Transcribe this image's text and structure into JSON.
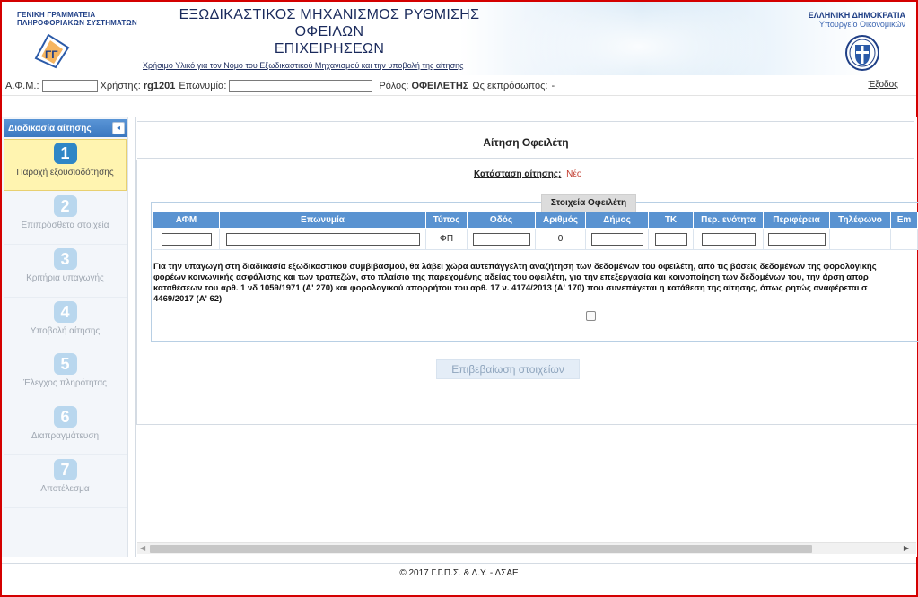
{
  "header": {
    "org_line1": "ΓΕΝΙΚΗ ΓΡΑΜΜΑΤΕΙΑ",
    "org_line2": "ΠΛΗΡΟΦΟΡΙΑΚΩΝ ΣΥΣΤΗΜΑΤΩΝ",
    "title_line1": "ΕΞΩΔΙΚΑΣΤΙΚΟΣ ΜΗΧΑΝΙΣΜΟΣ ΡΥΘΜΙΣΗΣ ΟΦΕΙΛΩΝ",
    "title_line2": "ΕΠΙΧΕΙΡΗΣΕΩΝ",
    "material_link": "Χρήσιμο Υλικό για τον Νόμο του Εξωδικαστικού Μηχανισμού και την υποβολή της αίτησης",
    "republic": "ΕΛΛΗΝΙΚΗ ΔΗΜΟΚΡΑΤΙΑ",
    "ministry": "Υπουργείο Οικονομικών",
    "logo_icon": "ggps-logo-icon",
    "emblem_icon": "greek-emblem-icon"
  },
  "userbar": {
    "afm_label": "Α.Φ.Μ.:",
    "user_label": "Χρήστης:",
    "user_value": "rg1201",
    "name_label": "Επωνυμία:",
    "role_label": "Ρόλος:",
    "role_value": "ΟΦΕΙΛΕΤΗΣ",
    "rep_label": "Ως εκπρόσωπος:",
    "rep_value": "-",
    "logout": "Έξοδος"
  },
  "sidebar": {
    "header": "Διαδικασία αίτησης",
    "collapse_icon": "◂",
    "steps": [
      {
        "num": "1",
        "label": "Παροχή εξουσιοδότησης"
      },
      {
        "num": "2",
        "label": "Επιπρόσθετα στοιχεία"
      },
      {
        "num": "3",
        "label": "Κριτήρια υπαγωγής"
      },
      {
        "num": "4",
        "label": "Υποβολή αίτησης"
      },
      {
        "num": "5",
        "label": "Έλεγχος πληρότητας"
      },
      {
        "num": "6",
        "label": "Διαπραγμάτευση"
      },
      {
        "num": "7",
        "label": "Αποτέλεσμα"
      }
    ]
  },
  "main": {
    "page_title": "Αίτηση Οφειλέτη",
    "status_label": "Κατάσταση αίτησης:",
    "status_value": "Νέο",
    "debtor_tab": "Στοιχεία Οφειλέτη",
    "columns": [
      "ΑΦΜ",
      "Επωνυμία",
      "Τύπος",
      "Οδός",
      "Αριθμός",
      "Δήμος",
      "ΤΚ",
      "Περ. ενότητα",
      "Περιφέρεια",
      "Τηλέφωνο",
      "Em"
    ],
    "row": {
      "type": "ΦΠ",
      "number": "0"
    },
    "legal_line1": "Για την υπαγωγή στη διαδικασία εξωδικαστικού συμβιβασμού, θα λάβει χώρα αυτεπάγγελτη αναζήτηση των δεδομένων του οφειλέτη, από τις βάσεις δεδομένων της φορολογικής",
    "legal_line2": "φορέων κοινωνικής ασφάλισης και των τραπεζών, στο πλαίσιο της παρεχομένης αδείας του οφειλέτη, για την επεξεργασία και κοινοποίηση των δεδομένων του, την άρση απορ",
    "legal_line3": "καταθέσεων του αρθ. 1 νδ 1059/1971 (Α' 270) και φορολογικού απορρήτου του αρθ. 17 ν. 4174/2013 (Α' 170) που συνεπάγεται η κατάθεση της αίτησης, όπως ρητώς αναφέρεται σ",
    "legal_line4": "4469/2017 (Α' 62)",
    "confirm_button": "Επιβεβαίωση στοιχείων"
  },
  "footer": {
    "text": "© 2017 Γ.Γ.Π.Σ. & Δ.Υ. - ΔΣΑΕ"
  }
}
